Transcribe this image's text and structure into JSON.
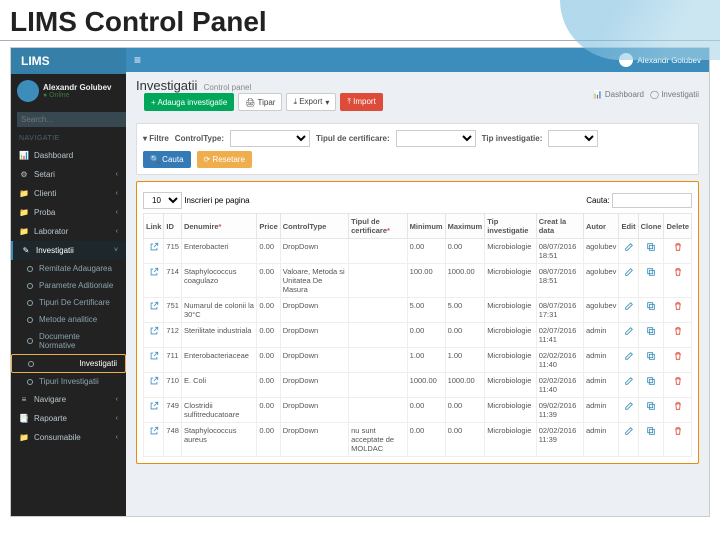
{
  "slide_title": "LIMS Control Panel",
  "brand": "LIMS",
  "user": {
    "name": "Alexandr Golubev",
    "status": "● Online"
  },
  "search_placeholder": "Search...",
  "nav_header": "NAVIGATIE",
  "nav": [
    {
      "icon": "📊",
      "label": "Dashboard",
      "chev": ""
    },
    {
      "icon": "⚙",
      "label": "Setari",
      "chev": "‹"
    },
    {
      "icon": "📁",
      "label": "Clienti",
      "chev": "‹"
    },
    {
      "icon": "📁",
      "label": "Proba",
      "chev": "‹"
    },
    {
      "icon": "📁",
      "label": "Laborator",
      "chev": "‹"
    }
  ],
  "nav_active": {
    "icon": "✎",
    "label": "Investigatii",
    "chev": "˅"
  },
  "sub_items": [
    "Remitate Adaugarea",
    "Parametre Aditionale",
    "Tipuri De Certificare",
    "Metode analitice",
    "Documente Normative",
    "Investigatii",
    "Tipuri Investigatii"
  ],
  "nav_tail": [
    {
      "icon": "≡",
      "label": "Navigare",
      "chev": "‹"
    },
    {
      "icon": "📑",
      "label": "Rapoarte",
      "chev": "‹"
    },
    {
      "icon": "📁",
      "label": "Consumabile",
      "chev": "‹"
    }
  ],
  "topbar_user": "Alexandr Golubev",
  "page": {
    "title": "Investigatii",
    "subtitle": "Control panel"
  },
  "toolbar": {
    "add": "+ Adauga investigatie",
    "print": "🖨 Tipar",
    "export": "⤓ Export",
    "import": "⤒ Import"
  },
  "breadcrumb": {
    "dash": "📊 Dashboard",
    "here": "◯ Investigatii"
  },
  "filter": {
    "title": "▾ Filtre",
    "f1": "ControlType:",
    "f2": "Tipul de certificare:",
    "f3": "Tip investigatie:",
    "search": "🔍 Cauta",
    "reset": "⟳ Resetare"
  },
  "grid": {
    "per_page_value": "10",
    "per_page_label": "Inscrieri pe pagina",
    "cauta_label": "Cauta:",
    "headers": {
      "link": "Link",
      "id": "ID",
      "den": "Denumire",
      "price": "Price",
      "ctrl": "ControlType",
      "cert": "Tipul de certificare",
      "min": "Minimum",
      "max": "Maximum",
      "tip": "Tip investigatie",
      "creat": "Creat la data",
      "autor": "Autor",
      "edit": "Edit",
      "clone": "Clone",
      "delete": "Delete"
    },
    "rows": [
      {
        "id": "715",
        "den": "Enterobacteri",
        "price": "0.00",
        "ctrl": "DropDown",
        "cert": "",
        "min": "0.00",
        "max": "0.00",
        "tip": "Microbiologie",
        "creat": "08/07/2016 18:51",
        "autor": "agolubev"
      },
      {
        "id": "714",
        "den": "Staphylococcus coagulazo",
        "price": "0.00",
        "ctrl": "Valoare, Metoda si Unitatea De Masura",
        "cert": "",
        "min": "100.00",
        "max": "1000.00",
        "tip": "Microbiologie",
        "creat": "08/07/2016 18:51",
        "autor": "agolubev"
      },
      {
        "id": "751",
        "den": "Numarul de colonii la 30°C",
        "price": "0.00",
        "ctrl": "DropDown",
        "cert": "",
        "min": "5.00",
        "max": "5.00",
        "tip": "Microbiologie",
        "creat": "08/07/2016 17:31",
        "autor": "agolubev"
      },
      {
        "id": "712",
        "den": "Sterilitate industriala",
        "price": "0.00",
        "ctrl": "DropDown",
        "cert": "",
        "min": "0.00",
        "max": "0.00",
        "tip": "Microbiologie",
        "creat": "02/07/2016 11:41",
        "autor": "admin"
      },
      {
        "id": "711",
        "den": "Enterobacteriaceae",
        "price": "0.00",
        "ctrl": "DropDown",
        "cert": "",
        "min": "1.00",
        "max": "1.00",
        "tip": "Microbiologie",
        "creat": "02/02/2016 11:40",
        "autor": "admin"
      },
      {
        "id": "710",
        "den": "E. Coli",
        "price": "0.00",
        "ctrl": "DropDown",
        "cert": "",
        "min": "1000.00",
        "max": "1000.00",
        "tip": "Microbiologie",
        "creat": "02/02/2016 11:40",
        "autor": "admin"
      },
      {
        "id": "749",
        "den": "Clostridii sulfitreducatoare",
        "price": "0.00",
        "ctrl": "DropDown",
        "cert": "",
        "min": "0.00",
        "max": "0.00",
        "tip": "Microbiologie",
        "creat": "09/02/2016 11:39",
        "autor": "admin"
      },
      {
        "id": "748",
        "den": "Staphylococcus aureus",
        "price": "0.00",
        "ctrl": "DropDown",
        "cert": "nu sunt acceptate de MOLDAC",
        "min": "0.00",
        "max": "0.00",
        "tip": "Microbiologie",
        "creat": "02/02/2016 11:39",
        "autor": "admin"
      }
    ]
  }
}
